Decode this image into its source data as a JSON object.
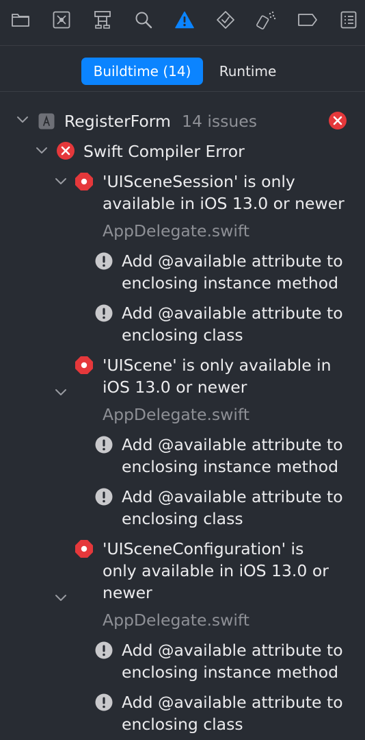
{
  "toolbar": {
    "icons": [
      "folder-icon",
      "source-control-icon",
      "hierarchy-icon",
      "search-icon",
      "warning-icon",
      "test-diamond-icon",
      "debug-spray-icon",
      "breakpoint-tag-icon",
      "report-list-icon"
    ]
  },
  "tabs": {
    "buildtime": "Buildtime (14)",
    "runtime": "Runtime"
  },
  "project": {
    "name": "RegisterForm",
    "issue_count": "14 issues"
  },
  "group": {
    "title": "Swift Compiler Error"
  },
  "errors": [
    {
      "message_lines": [
        "'UISceneSession' is only",
        "available in iOS 13.0 or newer"
      ],
      "file": "AppDelegate.swift",
      "fixits": [
        {
          "lines": [
            "Add @available attribute to",
            "enclosing instance method"
          ]
        },
        {
          "lines": [
            "Add @available attribute to",
            "enclosing class"
          ]
        }
      ]
    },
    {
      "message_lines": [
        "'UIScene' is only available in",
        "iOS 13.0 or newer"
      ],
      "file": "AppDelegate.swift",
      "fixits": [
        {
          "lines": [
            "Add @available attribute to",
            "enclosing instance method"
          ]
        },
        {
          "lines": [
            "Add @available attribute to",
            "enclosing class"
          ]
        }
      ]
    },
    {
      "message_lines": [
        "'UISceneConfiguration' is",
        "only available in iOS 13.0 or",
        "newer"
      ],
      "file": "AppDelegate.swift",
      "fixits": [
        {
          "lines": [
            "Add @available attribute to",
            "enclosing instance method"
          ]
        },
        {
          "lines": [
            "Add @available attribute to",
            "enclosing class"
          ]
        }
      ]
    }
  ],
  "colors": {
    "background": "#282c33",
    "accent": "#0b84ff",
    "error": "#e5383b",
    "warning_badge": "#c9c9cc"
  }
}
